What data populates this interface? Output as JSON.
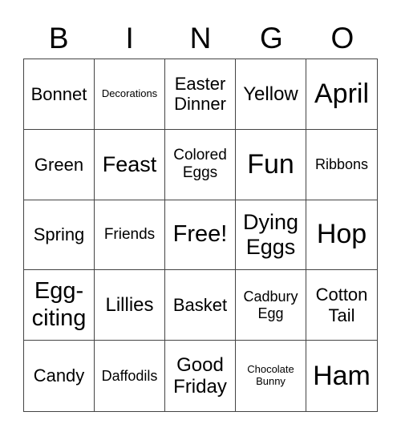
{
  "header": [
    "B",
    "I",
    "N",
    "G",
    "O"
  ],
  "cells": [
    "Bonnet",
    "Decorations",
    "Easter Dinner",
    "Yellow",
    "April",
    "Green",
    "Feast",
    "Colored Eggs",
    "Fun",
    "Ribbons",
    "Spring",
    "Friends",
    "Free!",
    "Dying Eggs",
    "Hop",
    "Egg-citing",
    "Lillies",
    "Basket",
    "Cadbury Egg",
    "Cotton Tail",
    "Candy",
    "Daffodils",
    "Good Friday",
    "Chocolate Bunny",
    "Ham"
  ]
}
